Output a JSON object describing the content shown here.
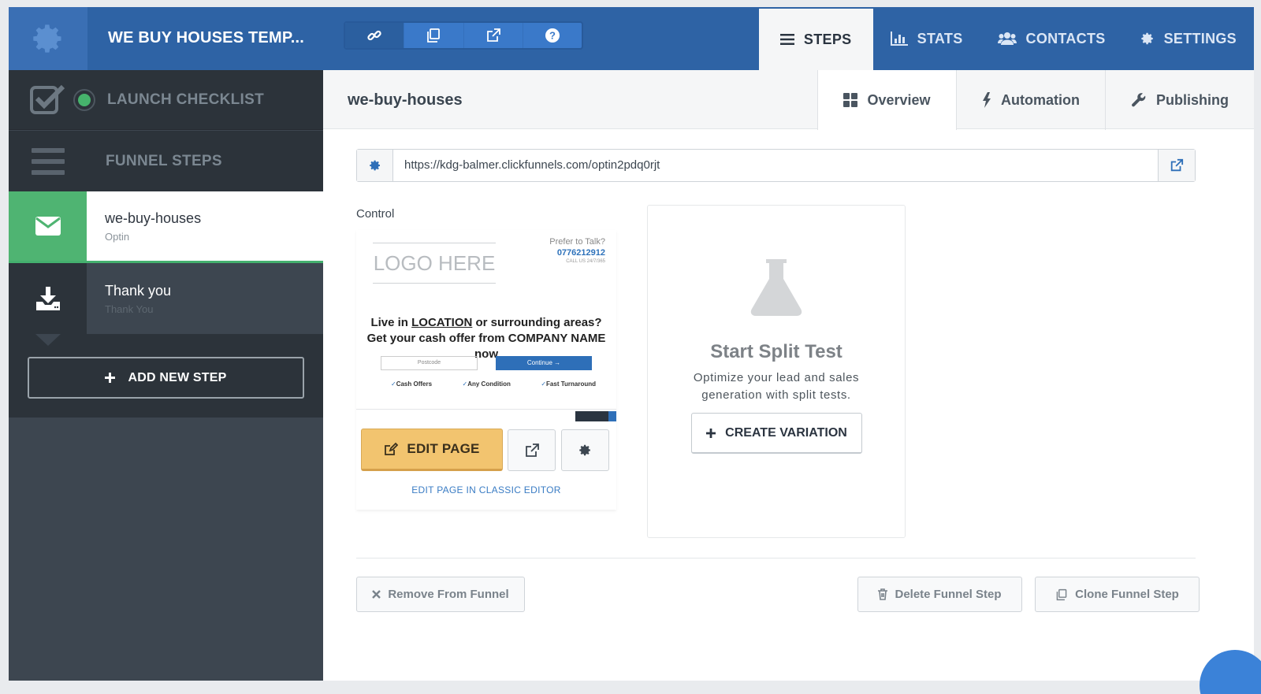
{
  "header": {
    "funnel_title": "WE BUY HOUSES TEMP...",
    "nav_tabs": [
      {
        "label": "STEPS",
        "icon": "list-icon"
      },
      {
        "label": "STATS",
        "icon": "bar-chart-icon"
      },
      {
        "label": "CONTACTS",
        "icon": "users-icon"
      },
      {
        "label": "SETTINGS",
        "icon": "gear-icon"
      }
    ],
    "toolbar_icons": [
      "link-icon",
      "copy-icon",
      "external-link-icon",
      "help-icon"
    ]
  },
  "sidebar": {
    "launch_checklist": "LAUNCH CHECKLIST",
    "funnel_steps": "FUNNEL STEPS",
    "steps": [
      {
        "name": "we-buy-houses",
        "type": "Optin"
      },
      {
        "name": "Thank you",
        "type": "Thank You"
      }
    ],
    "add_step": "ADD NEW STEP"
  },
  "page": {
    "slug": "we-buy-houses",
    "tabs": [
      {
        "label": "Overview",
        "icon": "grid-icon"
      },
      {
        "label": "Automation",
        "icon": "bolt-icon"
      },
      {
        "label": "Publishing",
        "icon": "wrench-icon"
      }
    ],
    "url": "https://kdg-balmer.clickfunnels.com/optin2pdq0rjt",
    "control_label": "Control"
  },
  "preview": {
    "logo": "LOGO HERE",
    "prefer_talk": "Prefer to Talk?",
    "phone": "0776212912",
    "call_note": "CALL US 24/7/365",
    "headline_1a": "Live in ",
    "headline_1b": "LOCATION",
    "headline_1c": " or surrounding areas?",
    "headline_2": "Get your cash offer from COMPANY NAME now",
    "postcode": "Postcode",
    "continue": "Continue →",
    "features": [
      "Cash Offers",
      "Any Condition",
      "Fast Turnaround"
    ]
  },
  "actions": {
    "edit_page": "EDIT PAGE",
    "classic_editor": "EDIT PAGE IN CLASSIC EDITOR",
    "split_title": "Start Split Test",
    "split_desc_1": "Optimize your lead and sales",
    "split_desc_2": "generation with split tests.",
    "create_variation": "CREATE VARIATION",
    "remove": "Remove From Funnel",
    "delete": "Delete Funnel Step",
    "clone": "Clone Funnel Step"
  },
  "colors": {
    "topbar": "#2e63a5",
    "sidebar": "#3d4650",
    "active_step": "#4fb472",
    "edit_button": "#f2c46f",
    "link": "#3a7cc4"
  }
}
